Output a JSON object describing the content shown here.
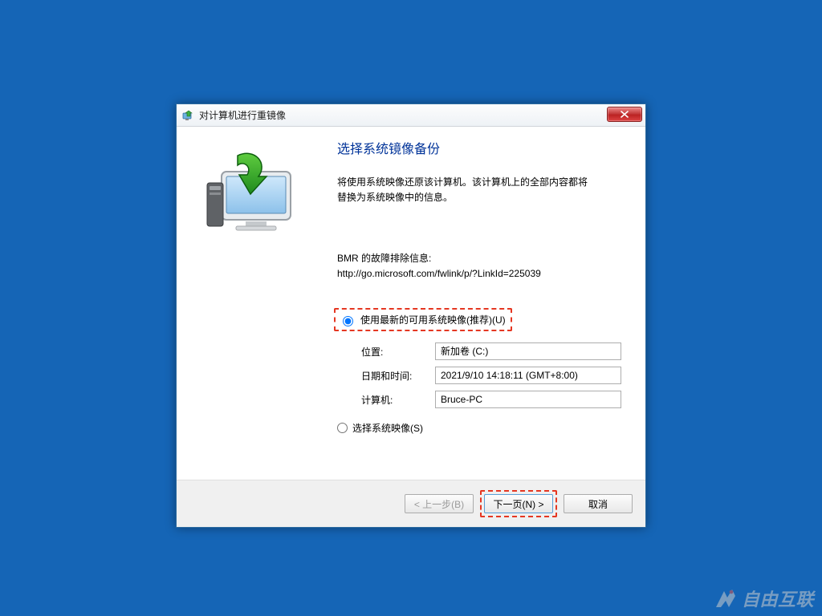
{
  "window": {
    "title": "对计算机进行重镜像"
  },
  "main": {
    "heading": "选择系统镜像备份",
    "description": "将使用系统映像还原该计算机。该计算机上的全部内容都将替换为系统映像中的信息。",
    "info_label": "BMR 的故障排除信息:",
    "info_url": "http://go.microsoft.com/fwlink/p/?LinkId=225039",
    "option_latest": "使用最新的可用系统映像(推荐)(U)",
    "option_select": "选择系统映像(S)",
    "details": {
      "location_label": "位置:",
      "location_value": "新加卷 (C:)",
      "datetime_label": "日期和时间:",
      "datetime_value": "2021/9/10 14:18:11 (GMT+8:00)",
      "computer_label": "计算机:",
      "computer_value": "Bruce-PC"
    }
  },
  "footer": {
    "back": "< 上一步(B)",
    "next": "下一页(N) >",
    "cancel": "取消"
  },
  "watermark": "自由互联"
}
